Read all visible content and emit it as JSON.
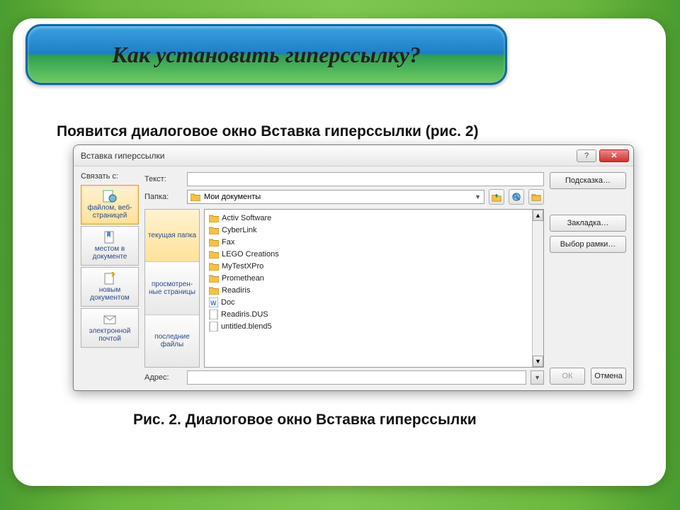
{
  "slide": {
    "title": "Как установить гиперссылку?",
    "subtitle": "Появится диалоговое окно Вставка гиперссылки (рис. 2)",
    "caption": "Рис. 2. Диалоговое окно Вставка гиперссылки"
  },
  "dialog": {
    "title": "Вставка гиперссылки",
    "link_with_label": "Связать с:",
    "text_label": "Текст:",
    "text_value": "",
    "folder_label": "Папка:",
    "folder_value": "Мои документы",
    "address_label": "Адрес:",
    "address_value": "",
    "link_options": [
      {
        "label": "файлом, веб-страницей",
        "selected": true
      },
      {
        "label": "местом в документе",
        "selected": false
      },
      {
        "label": "новым документом",
        "selected": false
      },
      {
        "label": "электронной почтой",
        "selected": false
      }
    ],
    "view_tabs": [
      {
        "label": "текущая папка",
        "selected": true
      },
      {
        "label": "просмотрен-ные страницы",
        "selected": false
      },
      {
        "label": "последние файлы",
        "selected": false
      }
    ],
    "files": [
      {
        "name": "Activ Software",
        "type": "folder"
      },
      {
        "name": "CyberLink",
        "type": "folder"
      },
      {
        "name": "Fax",
        "type": "folder"
      },
      {
        "name": "LEGO Creations",
        "type": "folder"
      },
      {
        "name": "MyTestXPro",
        "type": "folder"
      },
      {
        "name": "Promethean",
        "type": "folder"
      },
      {
        "name": "Readiris",
        "type": "folder"
      },
      {
        "name": "Doc",
        "type": "doc"
      },
      {
        "name": "Readiris.DUS",
        "type": "file"
      },
      {
        "name": "untitled.blend5",
        "type": "file"
      }
    ],
    "buttons": {
      "tooltip": "Подсказка…",
      "bookmark": "Закладка…",
      "target_frame": "Выбор рамки…",
      "ok": "ОК",
      "cancel": "Отмена"
    }
  }
}
